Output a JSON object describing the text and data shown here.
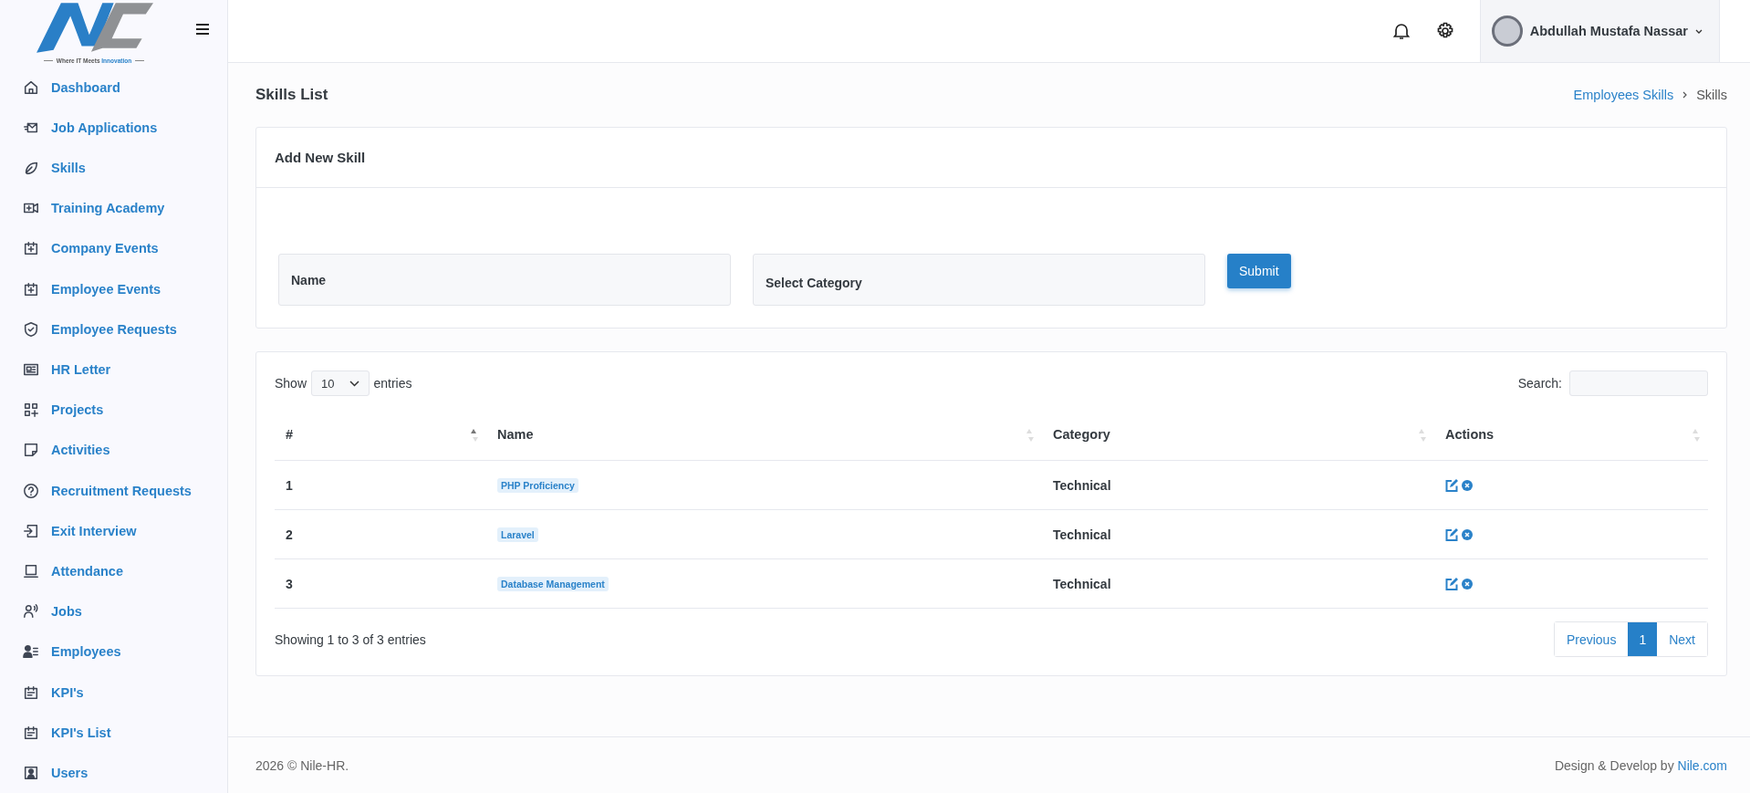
{
  "logo": {
    "tagline": "Where IT Meets",
    "tagline_highlight": "Innovation"
  },
  "sidebar": {
    "items": [
      {
        "label": "Dashboard"
      },
      {
        "label": "Job Applications"
      },
      {
        "label": "Skills"
      },
      {
        "label": "Training Academy"
      },
      {
        "label": "Company Events"
      },
      {
        "label": "Employee Events"
      },
      {
        "label": "Employee Requests"
      },
      {
        "label": "HR Letter"
      },
      {
        "label": "Projects"
      },
      {
        "label": "Activities"
      },
      {
        "label": "Recruitment Requests"
      },
      {
        "label": "Exit Interview"
      },
      {
        "label": "Attendance"
      },
      {
        "label": "Jobs"
      },
      {
        "label": "Employees"
      },
      {
        "label": "KPI's"
      },
      {
        "label": "KPI's List"
      },
      {
        "label": "Users"
      }
    ]
  },
  "header": {
    "user_name": "Abdullah Mustafa Nassar"
  },
  "page": {
    "title": "Skills List",
    "breadcrumb": [
      {
        "label": "Employees Skills",
        "kind": "link"
      },
      {
        "label": "Skills",
        "kind": "current"
      }
    ]
  },
  "form": {
    "title": "Add New Skill",
    "fields": [
      {
        "kind": "input",
        "placeholder": "Name"
      },
      {
        "kind": "select",
        "placeholder": "Select Category"
      }
    ],
    "submit": "Submit"
  },
  "table": {
    "length_label_before": "Show",
    "length_value": "10",
    "length_label_after": "entries",
    "search_label": "Search:",
    "columns": [
      {
        "label": "#",
        "sorted": true
      },
      {
        "label": "Name",
        "sorted": false
      },
      {
        "label": "Category",
        "sorted": false
      },
      {
        "label": "Actions",
        "sorted": false
      }
    ],
    "rows": [
      {
        "number": "1",
        "name": "PHP Proficiency",
        "category": "Technical"
      },
      {
        "number": "2",
        "name": "Laravel",
        "category": "Technical"
      },
      {
        "number": "3",
        "name": "Database Management",
        "category": "Technical"
      }
    ],
    "info": "Showing 1 to 3 of 3 entries",
    "pagination": {
      "previous": "Previous",
      "pages": [
        {
          "label": "1",
          "selected": true
        }
      ],
      "next": "Next"
    }
  },
  "footer": {
    "copyright": "2026 © Nile-HR.",
    "credit": "Design & Develop by",
    "credit_link": "Nile.com"
  }
}
